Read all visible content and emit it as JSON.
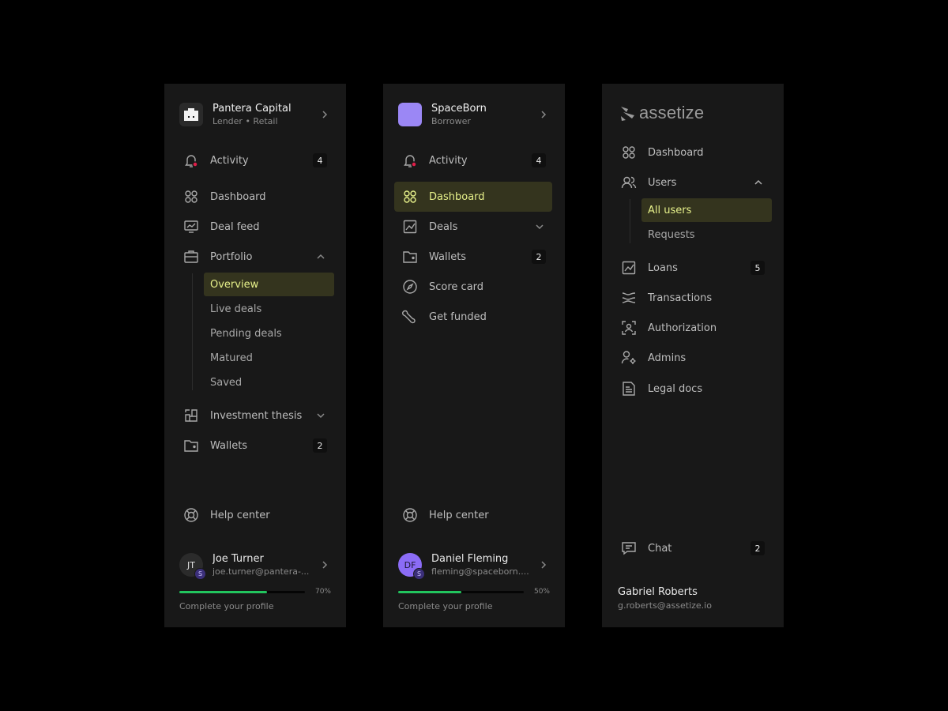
{
  "colors": {
    "background": "#000000",
    "panel": "#181818",
    "active_bg": "#34341e",
    "active_text": "#e6f08a",
    "progress": "#22c55e",
    "avatar_df": "#8b6cf6",
    "spaceborn_logo": "#9b87f5"
  },
  "panel1": {
    "org": {
      "name": "Pantera Capital",
      "sub": "Lender • Retail",
      "icon": "building-icon"
    },
    "activity": {
      "label": "Activity",
      "badge": "4"
    },
    "dashboard": {
      "label": "Dashboard"
    },
    "dealfeed": {
      "label": "Deal feed"
    },
    "portfolio": {
      "label": "Portfolio",
      "children": [
        "Overview",
        "Live deals",
        "Pending deals",
        "Matured",
        "Saved"
      ]
    },
    "thesis": {
      "label": "Investment thesis"
    },
    "wallets": {
      "label": "Wallets",
      "badge": "2"
    },
    "help": {
      "label": "Help center"
    },
    "user": {
      "initials": "JT",
      "badge": "S",
      "name": "Joe Turner",
      "email": "joe.turner@pantera-..."
    },
    "progress": {
      "percent": 70,
      "label": "70%",
      "cta": "Complete your profile"
    }
  },
  "panel2": {
    "org": {
      "name": "SpaceBorn",
      "sub": "Borrower"
    },
    "activity": {
      "label": "Activity",
      "badge": "4"
    },
    "dashboard": {
      "label": "Dashboard"
    },
    "deals": {
      "label": "Deals"
    },
    "wallets": {
      "label": "Wallets",
      "badge": "2"
    },
    "scorecard": {
      "label": "Score card"
    },
    "getfunded": {
      "label": "Get funded"
    },
    "help": {
      "label": "Help center"
    },
    "user": {
      "initials": "DF",
      "badge": "S",
      "name": "Daniel Fleming",
      "email": "fleming@spaceborn...."
    },
    "progress": {
      "percent": 50,
      "label": "50%",
      "cta": "Complete your profile"
    }
  },
  "panel3": {
    "brand": "assetize",
    "dashboard": {
      "label": "Dashboard"
    },
    "users": {
      "label": "Users",
      "children": [
        "All users",
        "Requests"
      ]
    },
    "loans": {
      "label": "Loans",
      "badge": "5"
    },
    "transactions": {
      "label": "Transactions"
    },
    "authorization": {
      "label": "Authorization"
    },
    "admins": {
      "label": "Admins"
    },
    "legal": {
      "label": "Legal docs"
    },
    "chat": {
      "label": "Chat",
      "badge": "2"
    },
    "user": {
      "name": "Gabriel Roberts",
      "email": "g.roberts@assetize.io"
    }
  }
}
